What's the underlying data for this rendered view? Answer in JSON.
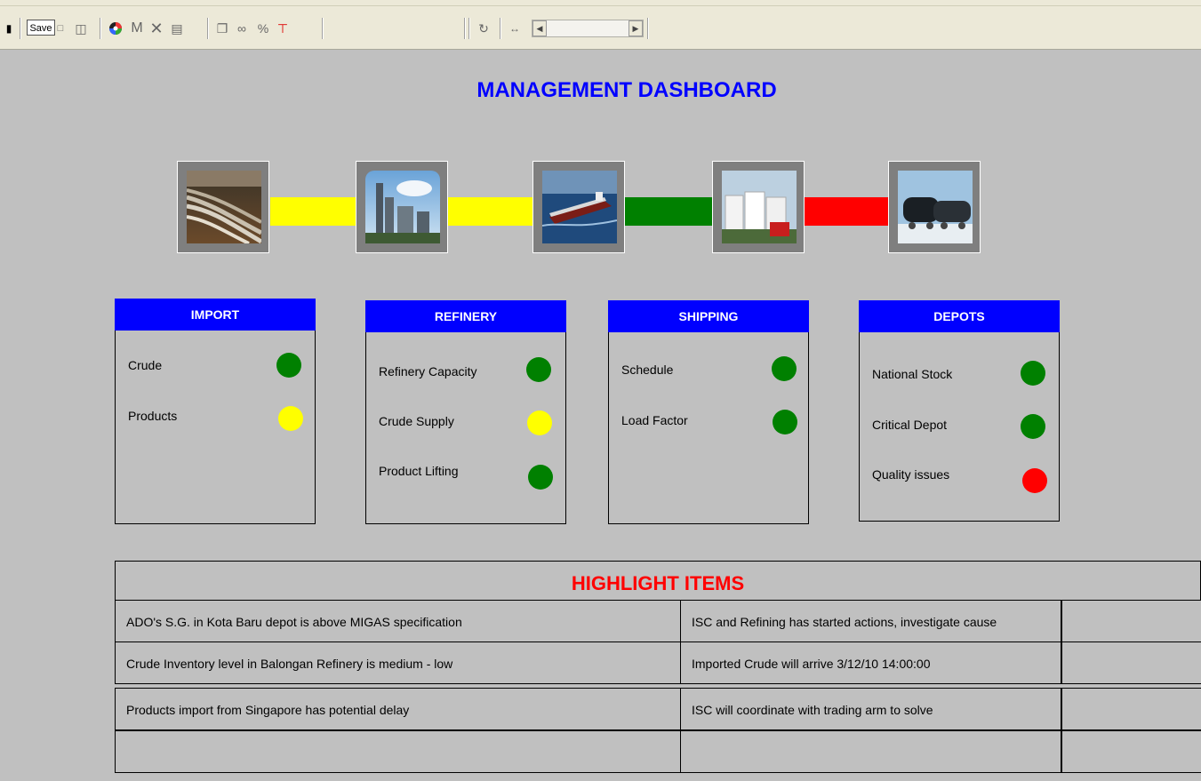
{
  "toolbar": {
    "save_label": "Save"
  },
  "title": "MANAGEMENT DASHBOARD",
  "flow": {
    "nodes": [
      {
        "name": "import-pipeline-image"
      },
      {
        "name": "refinery-image"
      },
      {
        "name": "tanker-ship-image"
      },
      {
        "name": "depot-storage-image"
      },
      {
        "name": "rail-tanker-image"
      }
    ],
    "links": [
      {
        "status": "yellow",
        "color": "#ffff00"
      },
      {
        "status": "yellow",
        "color": "#ffff00"
      },
      {
        "status": "green",
        "color": "#008000"
      },
      {
        "status": "red",
        "color": "#ff0000"
      }
    ]
  },
  "cards": [
    {
      "header": "IMPORT",
      "items": [
        {
          "label": "Crude",
          "status": "green"
        },
        {
          "label": "Products",
          "status": "yellow"
        }
      ]
    },
    {
      "header": "REFINERY",
      "items": [
        {
          "label": "Refinery Capacity",
          "status": "green"
        },
        {
          "label": "Crude Supply",
          "status": "yellow"
        },
        {
          "label": "Product Lifting",
          "status": "green"
        }
      ]
    },
    {
      "header": "SHIPPING",
      "items": [
        {
          "label": "Schedule",
          "status": "green"
        },
        {
          "label": "Load Factor",
          "status": "green"
        }
      ]
    },
    {
      "header": "DEPOTS",
      "items": [
        {
          "label": "National Stock",
          "status": "green"
        },
        {
          "label": "Critical Depot",
          "status": "green"
        },
        {
          "label": "Quality issues",
          "status": "red"
        }
      ]
    }
  ],
  "status_colors": {
    "green": "#008000",
    "yellow": "#ffff00",
    "red": "#ff0000",
    "header_blue": "#0000ff"
  },
  "highlights": {
    "title": "HIGHLIGHT ITEMS",
    "rows": [
      {
        "issue": "ADO's S.G. in Kota Baru depot is above MIGAS specification",
        "action": "ISC and Refining has started actions, investigate cause",
        "extra": ""
      },
      {
        "issue": "Crude Inventory level  in Balongan Refinery is medium - low",
        "action": "Imported Crude will arrive 3/12/10 14:00:00",
        "extra": ""
      },
      {
        "issue": "Products import from Singapore has potential delay",
        "action": "ISC will coordinate with trading arm to solve",
        "extra": ""
      },
      {
        "issue": "",
        "action": "",
        "extra": ""
      }
    ]
  }
}
